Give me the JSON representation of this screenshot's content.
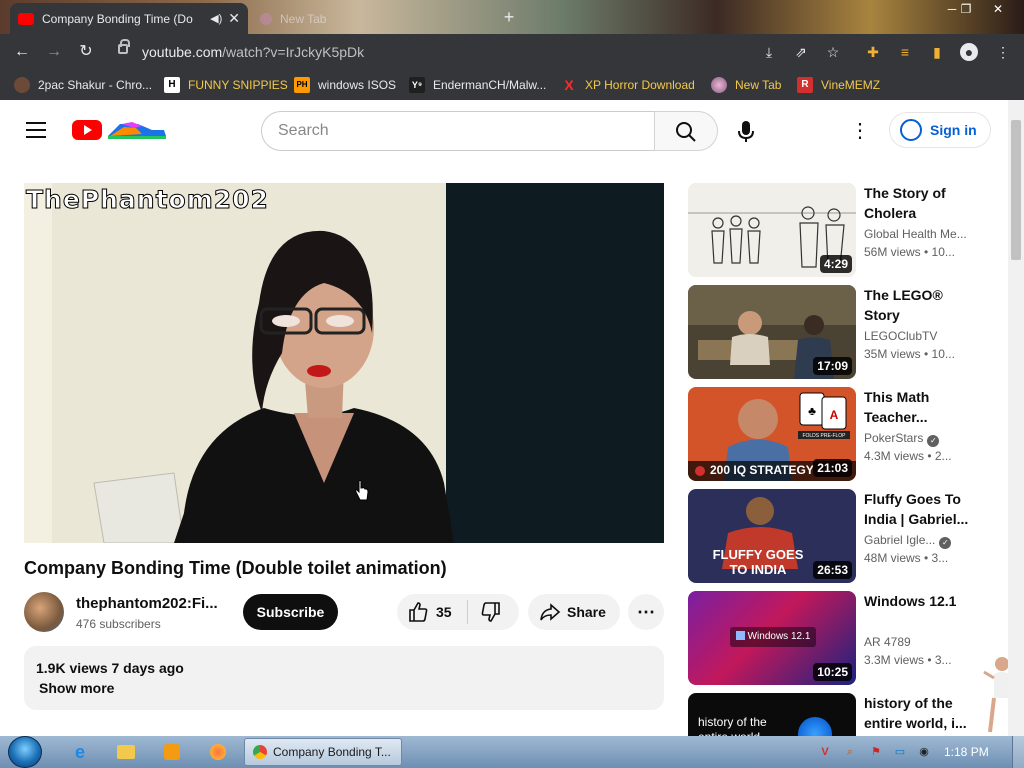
{
  "browser": {
    "active_tab_title": "Company Bonding Time (Do",
    "inactive_tab_title": "New Tab",
    "url_host": "youtube.com",
    "url_path": "/watch?v=IrJckyK5pDk",
    "bookmarks": [
      {
        "label": "2pac Shakur - Chro...",
        "icon": "tupac-icon"
      },
      {
        "label": "FUNNY SNIPPIES",
        "icon": "h-icon"
      },
      {
        "label": "windows ISOS",
        "icon": "ph-icon"
      },
      {
        "label": "EndermanCH/Malw...",
        "icon": "yp-icon"
      },
      {
        "label": "XP Horror Download",
        "icon": "x-icon"
      },
      {
        "label": "New Tab",
        "icon": "globe-icon"
      },
      {
        "label": "VineMEMZ",
        "icon": "r-icon"
      }
    ],
    "bookmark_badges": {
      "h": "H",
      "ph": "PH",
      "yp": "Y⁹",
      "x": "X",
      "r": "R"
    }
  },
  "youtube": {
    "search_placeholder": "Search",
    "sign_in": "Sign in"
  },
  "video": {
    "watermark": "ThePhantom202",
    "title": "Company Bonding Time (Double toilet animation)",
    "channel_name": "thephantom202:Fi...",
    "subscribers": "476 subscribers",
    "subscribe_label": "Subscribe",
    "like_count": "35",
    "share_label": "Share",
    "more_label": "⋯",
    "stats": "1.9K views  7 days ago",
    "show_more": "Show more"
  },
  "recommendations": [
    {
      "title": "The Story of Cholera",
      "channel": "Global Health Me...",
      "meta": "56M views  •  10...",
      "duration": "4:29",
      "verified": false
    },
    {
      "title": "The LEGO® Story",
      "channel": "LEGOClubTV",
      "meta": "35M views  •  10...",
      "duration": "17:09",
      "verified": false
    },
    {
      "title": "This Math Teacher...",
      "channel": "PokerStars",
      "meta": "4.3M views  •  2...",
      "duration": "21:03",
      "verified": true,
      "thumb_text": "200 IQ STRATEGY",
      "thumb_badge": "FOLDS PRE-FLOP"
    },
    {
      "title": "Fluffy Goes To India | Gabriel...",
      "channel": "Gabriel Igle...",
      "meta": "48M views  •  3...",
      "duration": "26:53",
      "verified": true,
      "thumb_text": "FLUFFY GOES TO INDIA"
    },
    {
      "title": "Windows 12.1",
      "channel": "AR 4789",
      "meta": "3.3M views  •  3...",
      "duration": "10:25",
      "verified": false,
      "thumb_text": "Windows 12.1"
    },
    {
      "title": "history of the entire world, i...",
      "channel": "",
      "meta": "",
      "duration": "",
      "verified": false,
      "thumb_text": "history of the entire world"
    }
  ],
  "taskbar": {
    "task_title": "Company Bonding T...",
    "clock": "1:18 PM"
  },
  "colors": {
    "youtube_red": "#ff0000",
    "signin_blue": "#065fd4",
    "chrome_dark": "#35363a"
  }
}
